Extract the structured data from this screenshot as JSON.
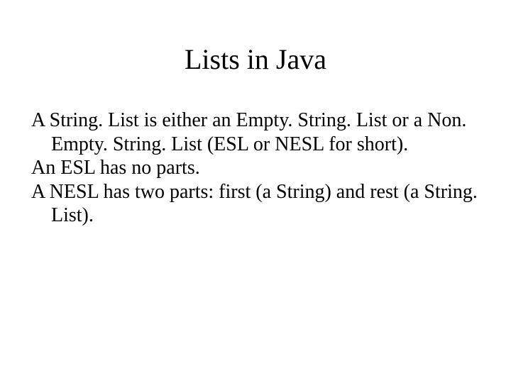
{
  "slide": {
    "title": "Lists in Java",
    "paragraphs": [
      "A String. List is either an Empty. String. List or a Non. Empty. String. List (ESL or NESL for short).",
      "An ESL has no parts.",
      "A NESL has two parts: first (a String) and rest (a String. List)."
    ]
  }
}
